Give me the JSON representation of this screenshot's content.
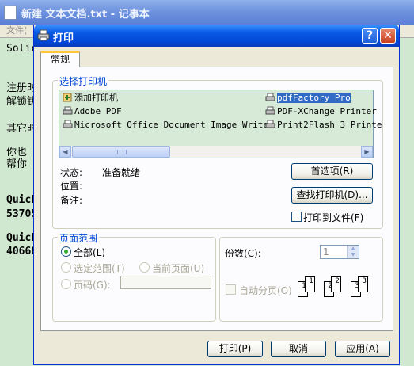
{
  "notepad": {
    "title": "新建 文本文档.txt - 记事本",
    "menu_file": "文件(",
    "lines": [
      "Solic",
      "注册时",
      "解锁钥",
      "其它时",
      "你也",
      "帮你",
      "Quick",
      "53705",
      "Quick",
      "40668"
    ]
  },
  "dialog": {
    "title": "打印",
    "help_label": "?",
    "close_label": "✕",
    "tab_general": "常规",
    "select_printer": {
      "legend": "选择打印机",
      "printers": [
        {
          "label": "添加打印机",
          "icon": "add-printer-icon"
        },
        {
          "label": "Adobe PDF",
          "icon": "printer-icon"
        },
        {
          "label": "Microsoft Office Document Image Writer",
          "icon": "printer-icon"
        },
        {
          "label": "pdfFactory Pro",
          "icon": "printer-icon",
          "selected": true
        },
        {
          "label": "PDF-XChange Printer",
          "icon": "printer-icon"
        },
        {
          "label": "Print2Flash 3 Printe",
          "icon": "printer-icon"
        }
      ],
      "status_label": "状态:",
      "status_value": "准备就绪",
      "location_label": "位置:",
      "comment_label": "备注:",
      "preferences_button": "首选项(R)",
      "find_printer_button": "查找打印机(D)...",
      "print_to_file_label": "打印到文件(F)"
    },
    "page_range": {
      "legend": "页面范围",
      "all_label": "全部(L)",
      "selection_label": "选定范围(T)",
      "current_page_label": "当前页面(U)",
      "pages_label": "页码(G):"
    },
    "copies": {
      "label": "份数(C):",
      "value": "1",
      "collate_label": "自动分页(O)",
      "collate_pages": [
        "1",
        "1",
        "2",
        "2",
        "3",
        "3"
      ]
    },
    "buttons": {
      "print": "打印(P)",
      "cancel": "取消",
      "apply": "应用(A)"
    },
    "colors": {
      "title_bar": "#0a5ae6",
      "selection": "#316ac5",
      "printer_list_bg": "#d7ead7"
    }
  }
}
